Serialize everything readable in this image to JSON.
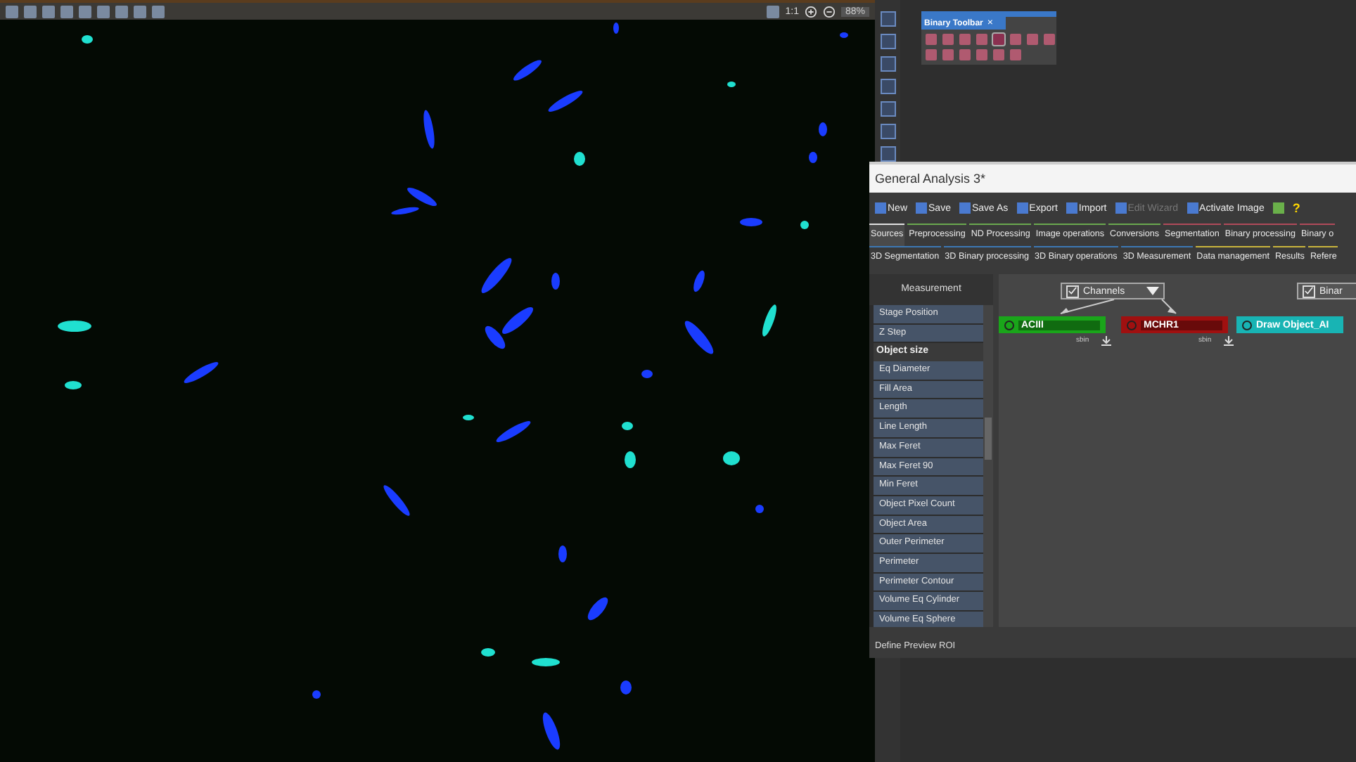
{
  "image_toolbar": {
    "zoom_ratio": "1:1",
    "zoom": "88%"
  },
  "binary_toolbar": {
    "title": "Binary Toolbar",
    "close": "×"
  },
  "analysis_window": {
    "title": "General Analysis 3*",
    "toolbar": [
      {
        "label": "New",
        "disabled": false
      },
      {
        "label": "Save",
        "disabled": false
      },
      {
        "label": "Save As",
        "disabled": false
      },
      {
        "label": "Export",
        "disabled": false
      },
      {
        "label": "Import",
        "disabled": false
      },
      {
        "label": "Edit Wizard",
        "disabled": true
      },
      {
        "label": "Activate Image",
        "disabled": false
      }
    ],
    "help": "?",
    "tabs_row1": [
      {
        "label": "Sources",
        "selected": true,
        "color": "#e0e0e0"
      },
      {
        "label": "Preprocessing",
        "selected": false,
        "color": "#6aa84f"
      },
      {
        "label": "ND Processing",
        "selected": false,
        "color": "#6aa84f"
      },
      {
        "label": "Image operations",
        "selected": false,
        "color": "#6aa84f"
      },
      {
        "label": "Conversions",
        "selected": false,
        "color": "#6aa84f"
      },
      {
        "label": "Segmentation",
        "selected": false,
        "color": "#b04a5a"
      },
      {
        "label": "Binary processing",
        "selected": false,
        "color": "#b04a5a"
      },
      {
        "label": "Binary o",
        "selected": false,
        "color": "#b04a5a"
      }
    ],
    "tabs_row2": [
      {
        "label": "3D Segmentation",
        "selected": false,
        "color": "#3c78b4"
      },
      {
        "label": "3D Binary processing",
        "selected": false,
        "color": "#3c78b4"
      },
      {
        "label": "3D Binary operations",
        "selected": false,
        "color": "#3c78b4"
      },
      {
        "label": "3D Measurement",
        "selected": false,
        "color": "#3c78b4"
      },
      {
        "label": "Data management",
        "selected": false,
        "color": "#c8b43c"
      },
      {
        "label": "Results",
        "selected": false,
        "color": "#c8b43c"
      },
      {
        "label": "Refere",
        "selected": false,
        "color": "#c8b43c"
      }
    ],
    "panel_title": "Measurement",
    "measurements": [
      {
        "label": "Stage Position",
        "kind": "item"
      },
      {
        "label": "Z Step",
        "kind": "item"
      },
      {
        "label": "Object size",
        "kind": "header"
      },
      {
        "label": "Eq Diameter",
        "kind": "item"
      },
      {
        "label": "Fill Area",
        "kind": "item"
      },
      {
        "label": "Length",
        "kind": "item"
      },
      {
        "label": "Line Length",
        "kind": "item"
      },
      {
        "label": "Max Feret",
        "kind": "item"
      },
      {
        "label": "Max Feret 90",
        "kind": "item"
      },
      {
        "label": "Min Feret",
        "kind": "item"
      },
      {
        "label": "Object Pixel Count",
        "kind": "item"
      },
      {
        "label": "Object Area",
        "kind": "item"
      },
      {
        "label": "Outer Perimeter",
        "kind": "item"
      },
      {
        "label": "Perimeter",
        "kind": "item"
      },
      {
        "label": "Perimeter Contour",
        "kind": "item"
      },
      {
        "label": "Volume Eq Cylinder",
        "kind": "item"
      },
      {
        "label": "Volume Eq Sphere",
        "kind": "item"
      }
    ],
    "groups": [
      {
        "label": "Channels",
        "checked": true
      },
      {
        "label": "Binar",
        "checked": true
      }
    ],
    "nodes": [
      {
        "label": "ACIII",
        "color": "#1aa51a",
        "footer": "sbin"
      },
      {
        "label": "MCHR1",
        "color": "#a01010",
        "footer": "sbin"
      },
      {
        "label": "Draw Object_AI",
        "color": "#18b4b4"
      }
    ],
    "status": "Define Preview ROI"
  }
}
